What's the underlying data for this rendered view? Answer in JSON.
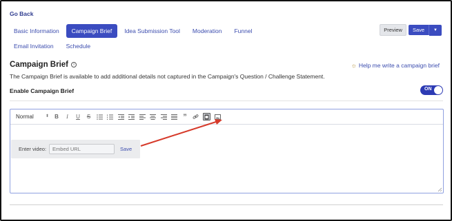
{
  "nav": {
    "go_back": "Go Back"
  },
  "tabs": [
    {
      "label": "Basic Information",
      "active": false
    },
    {
      "label": "Campaign Brief",
      "active": true
    },
    {
      "label": "Idea Submission Tool",
      "active": false
    },
    {
      "label": "Moderation",
      "active": false
    },
    {
      "label": "Funnel",
      "active": false
    },
    {
      "label": "Email Invitation",
      "active": false
    },
    {
      "label": "Schedule",
      "active": false
    }
  ],
  "actions": {
    "preview": "Preview",
    "save": "Save"
  },
  "section": {
    "title": "Campaign Brief",
    "help_link": "Help me write a campaign brief",
    "description": "The Campaign Brief is available to add additional details not captured in the Campaign's Question / Challenge Statement.",
    "enable_label": "Enable Campaign Brief",
    "toggle_state": "ON"
  },
  "editor": {
    "format_select": "Normal",
    "toolbar_icons": [
      "bold-icon",
      "italic-icon",
      "underline-icon",
      "strikethrough-icon",
      "bullet-list-icon",
      "ordered-list-icon",
      "outdent-icon",
      "indent-icon",
      "align-left-icon",
      "align-center-icon",
      "align-right-icon",
      "align-justify-icon",
      "blockquote-icon",
      "link-icon",
      "video-icon",
      "image-icon"
    ],
    "video_popup": {
      "label": "Enter video:",
      "placeholder": "Embed URL",
      "save": "Save"
    }
  },
  "colors": {
    "accent": "#3b4cc0",
    "annotation_arrow": "#d63a2a"
  }
}
